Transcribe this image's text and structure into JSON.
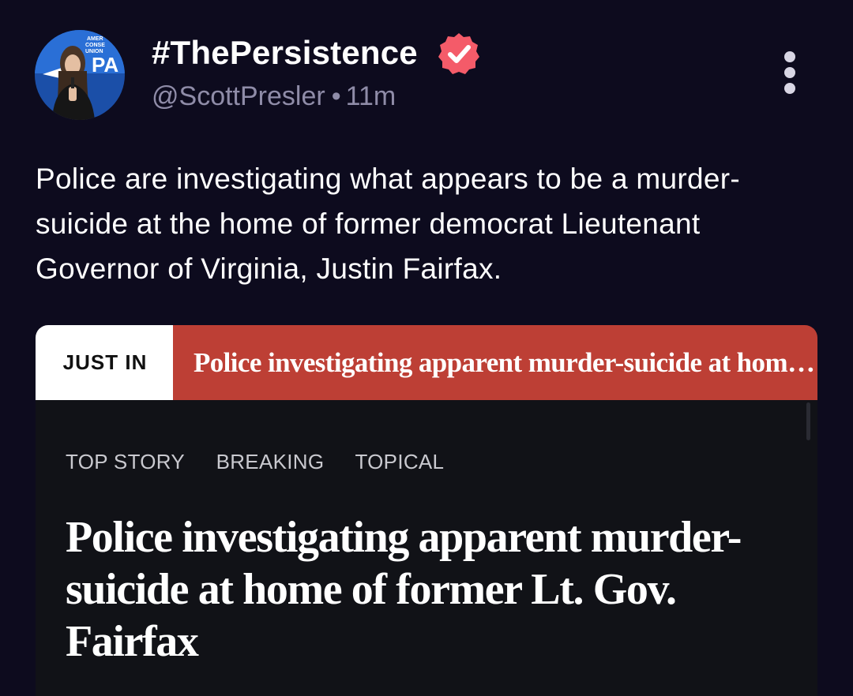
{
  "post": {
    "display_name": "#ThePersistence",
    "verified_icon": "verified-badge-icon",
    "handle": "@ScottPresler",
    "separator": "•",
    "time": "11m",
    "more_icon": "more-vertical-icon",
    "text": "Police are investigating what appears to be a murder-suicide at the home of former democrat Lieutenant Governor of Virginia, Justin Fairfax."
  },
  "avatar": {
    "backdrop_text": "AMERICAN CONSERVATIVE UNION",
    "logo_text": "CPA"
  },
  "card": {
    "just_in_label": "JUST IN",
    "ticker_headline": "Police investigating apparent murder-suicide at home of former Lt. Gov. Fairfax",
    "tags": [
      "TOP STORY",
      "BREAKING",
      "TOPICAL"
    ],
    "headline": "Police investigating apparent murder-suicide at home of former Lt. Gov. Fairfax"
  },
  "colors": {
    "background": "#0d0b1e",
    "verified": "#f45b69",
    "ticker": "#bd3f35",
    "card_background": "#111217",
    "meta_text": "#8f8ca8"
  }
}
